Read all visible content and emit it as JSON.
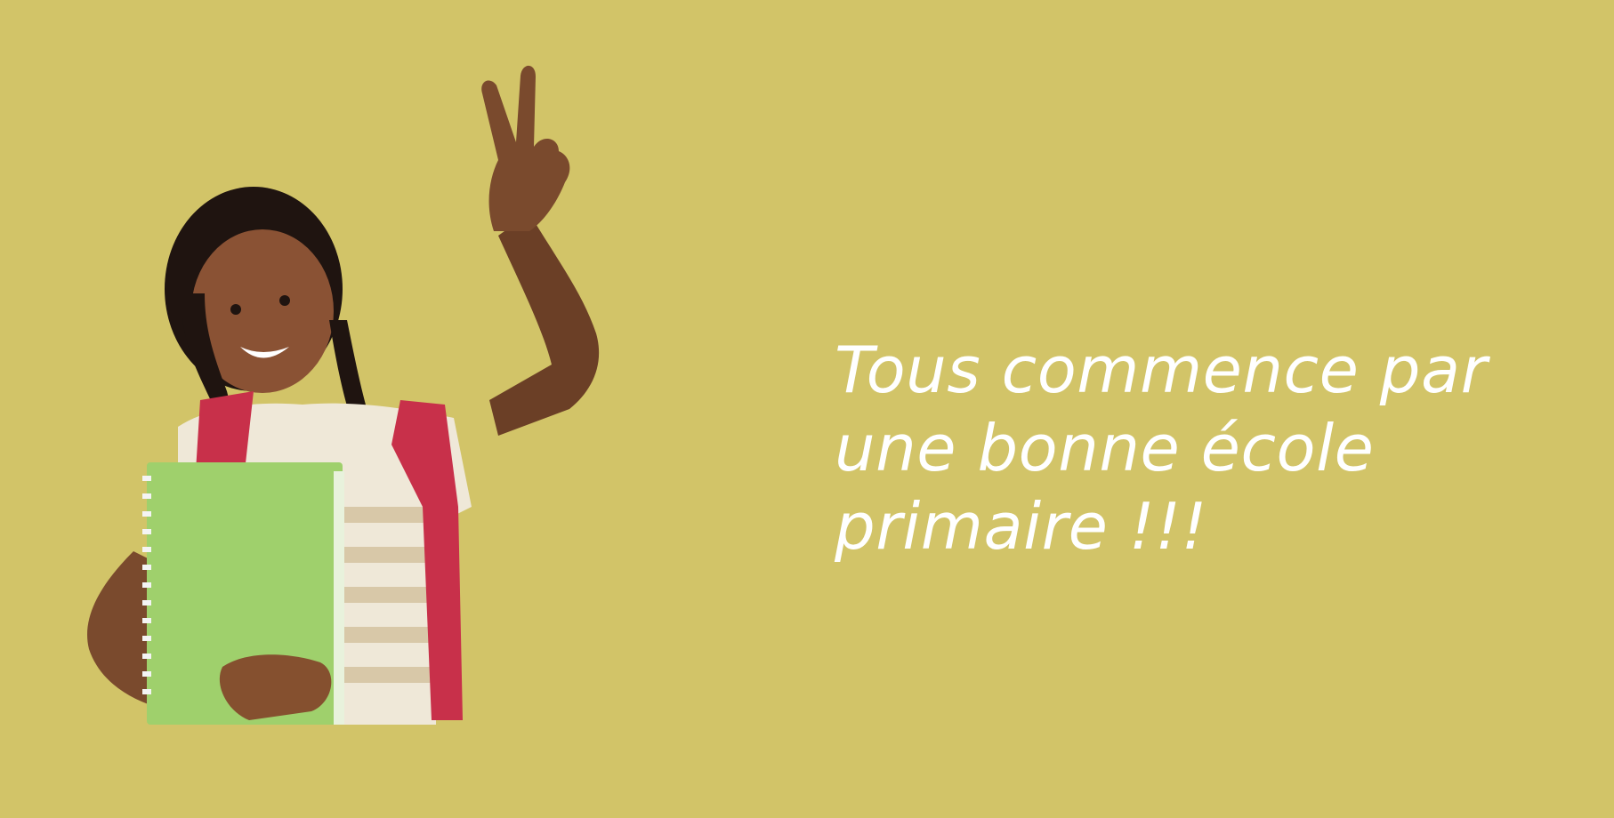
{
  "page": {
    "background_color": "#d2c468",
    "text_color": "#ffffff"
  },
  "hero_image": {
    "subject": "smiling schoolgirl with red backpack holding green notebook, making peace sign"
  },
  "headline": {
    "lines": [
      "Tous commence par",
      "une bonne école",
      "primaire !!!"
    ]
  }
}
